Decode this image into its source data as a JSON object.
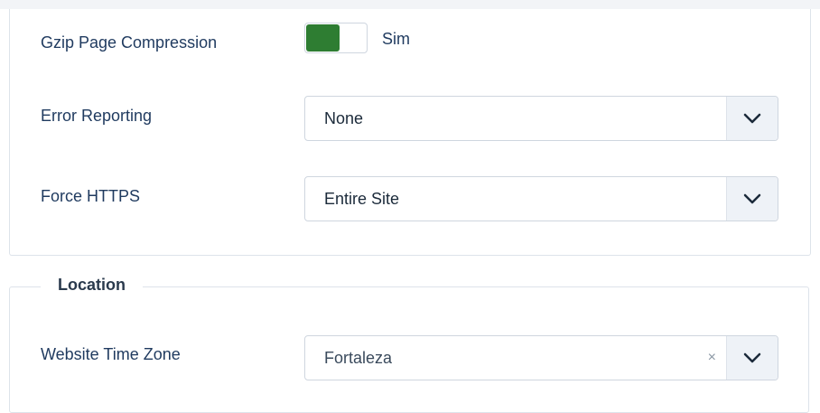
{
  "settings": {
    "gzip": {
      "label": "Gzip Page Compression",
      "value_text": "Sim",
      "enabled": true,
      "on_color": "#2e7d32"
    },
    "error_reporting": {
      "label": "Error Reporting",
      "value": "None"
    },
    "force_https": {
      "label": "Force HTTPS",
      "value": "Entire Site"
    }
  },
  "location": {
    "legend": "Location",
    "timezone": {
      "label": "Website Time Zone",
      "value": "Fortaleza",
      "clear_symbol": "×"
    }
  },
  "icons": {
    "dropdown": "chevron-down-icon",
    "clear": "close-icon"
  }
}
